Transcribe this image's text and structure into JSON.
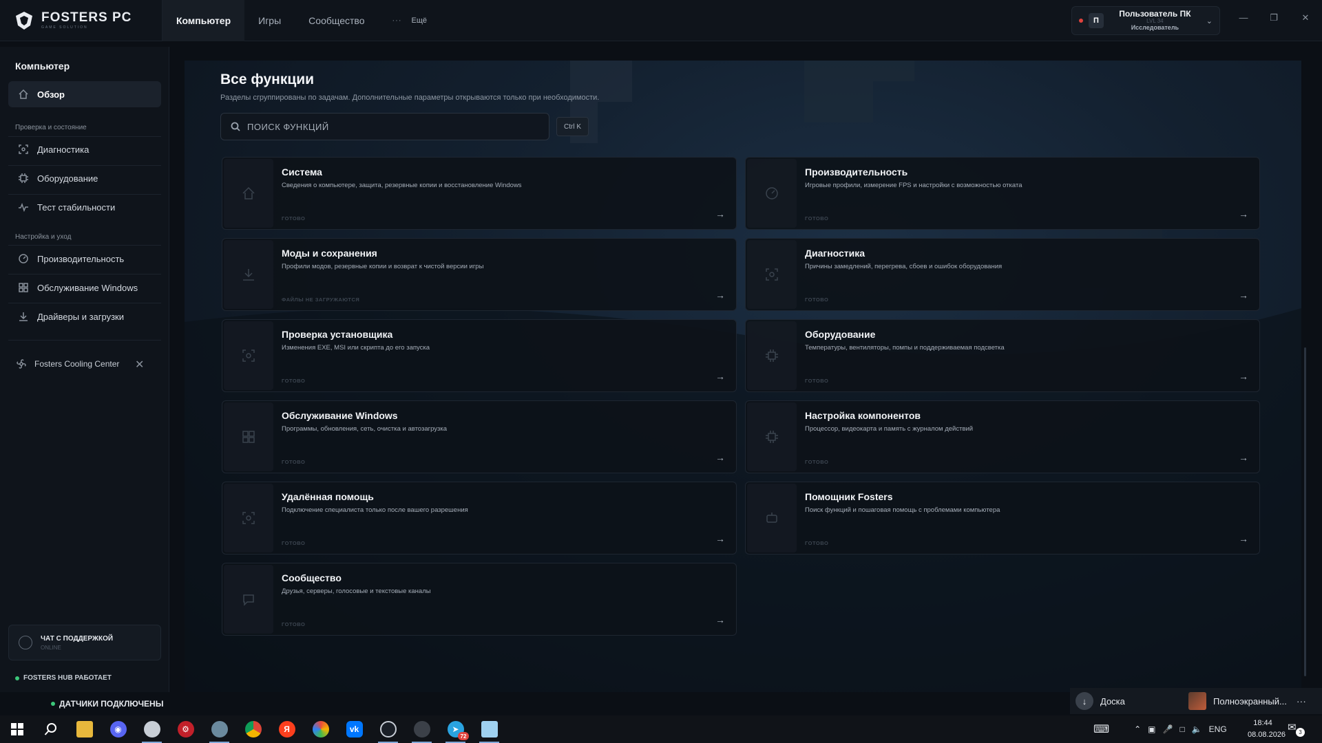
{
  "app": {
    "title": "FOSTERS PC",
    "subtitle": "GAME SOLUTION"
  },
  "nav": {
    "tabs": [
      "Компьютер",
      "Игры",
      "Сообщество"
    ],
    "more_dots": "···",
    "more_label": "Ещё"
  },
  "user": {
    "avatar_letter": "П",
    "name": "Пользователь ПК",
    "level": "LVL 34",
    "role": "Исследователь"
  },
  "sidebar": {
    "title": "Компьютер",
    "overview": "Обзор",
    "section_check": "Проверка и состояние",
    "check_items": [
      "Диагностика",
      "Оборудование",
      "Тест стабильности"
    ],
    "section_setup": "Настройка и уход",
    "setup_items": [
      "Производительность",
      "Обслуживание Windows",
      "Драйверы и загрузки"
    ],
    "cooling": "Fosters Cooling Center",
    "chat_title": "ЧАТ С ПОДДЕРЖКОЙ",
    "chat_status": "ONLINE",
    "hub_status": "FOSTERS HUB РАБОТАЕТ",
    "sensors": "ДАТЧИКИ ПОДКЛЮЧЕНЫ"
  },
  "main": {
    "title": "Все функции",
    "subtitle": "Разделы сгруппированы по задачам. Дополнительные параметры открываются только при необходимости.",
    "search_placeholder": "ПОИСК ФУНКЦИЙ",
    "shortcut": "Ctrl K",
    "cards": [
      {
        "title": "Система",
        "desc": "Сведения о компьютере, защита, резервные копии и восстановление Windows",
        "status": "ГОТОВО",
        "icon": "home-icon"
      },
      {
        "title": "Производительность",
        "desc": "Игровые профили, измерение FPS и настройки с возможностью отката",
        "status": "ГОТОВО",
        "icon": "gauge-icon"
      },
      {
        "title": "Моды и сохранения",
        "desc": "Профили модов, резервные копии и возврат к чистой версии игры",
        "status": "ФАЙЛЫ НЕ ЗАГРУЖАЮТСЯ",
        "icon": "download-icon"
      },
      {
        "title": "Диагностика",
        "desc": "Причины замедлений, перегрева, сбоев и ошибок оборудования",
        "status": "ГОТОВО",
        "icon": "scan-icon"
      },
      {
        "title": "Проверка установщика",
        "desc": "Изменения EXE, MSI или скрипта до его запуска",
        "status": "ГОТОВО",
        "icon": "scan-icon"
      },
      {
        "title": "Оборудование",
        "desc": "Температуры, вентиляторы, помпы и поддерживаемая подсветка",
        "status": "ГОТОВО",
        "icon": "chip-icon"
      },
      {
        "title": "Обслуживание Windows",
        "desc": "Программы, обновления, сеть, очистка и автозагрузка",
        "status": "ГОТОВО",
        "icon": "windows-icon"
      },
      {
        "title": "Настройка компонентов",
        "desc": "Процессор, видеокарта и память с журналом действий",
        "status": "ГОТОВО",
        "icon": "chip-icon"
      },
      {
        "title": "Удалённая помощь",
        "desc": "Подключение специалиста только после вашего разрешения",
        "status": "ГОТОВО",
        "icon": "scan-icon"
      },
      {
        "title": "Помощник Fosters",
        "desc": "Поиск функций и пошаговая помощь с проблемами компьютера",
        "status": "ГОТОВО",
        "icon": "bot-icon"
      },
      {
        "title": "Сообщество",
        "desc": "Друзья, серверы, голосовые и текстовые каналы",
        "status": "ГОТОВО",
        "icon": "chat-icon"
      }
    ]
  },
  "notifications": {
    "doska": "Доска",
    "fullscreen": "Полноэкранный...",
    "more": "···"
  },
  "taskbar": {
    "apps": [
      "start-icon",
      "search-icon",
      "explorer-icon",
      "discord-icon",
      "browser-icon",
      "app-red-icon",
      "app-dragon-icon",
      "chrome-icon",
      "yandex-icon",
      "app-color-icon",
      "vk-icon",
      "app-clock-icon",
      "app-gray-icon",
      "telegram-icon",
      "notes-icon"
    ],
    "telegram_badge": "72",
    "lang": "ENG",
    "time": "18:44",
    "date": "08.08.2026",
    "notif_count": "3"
  }
}
